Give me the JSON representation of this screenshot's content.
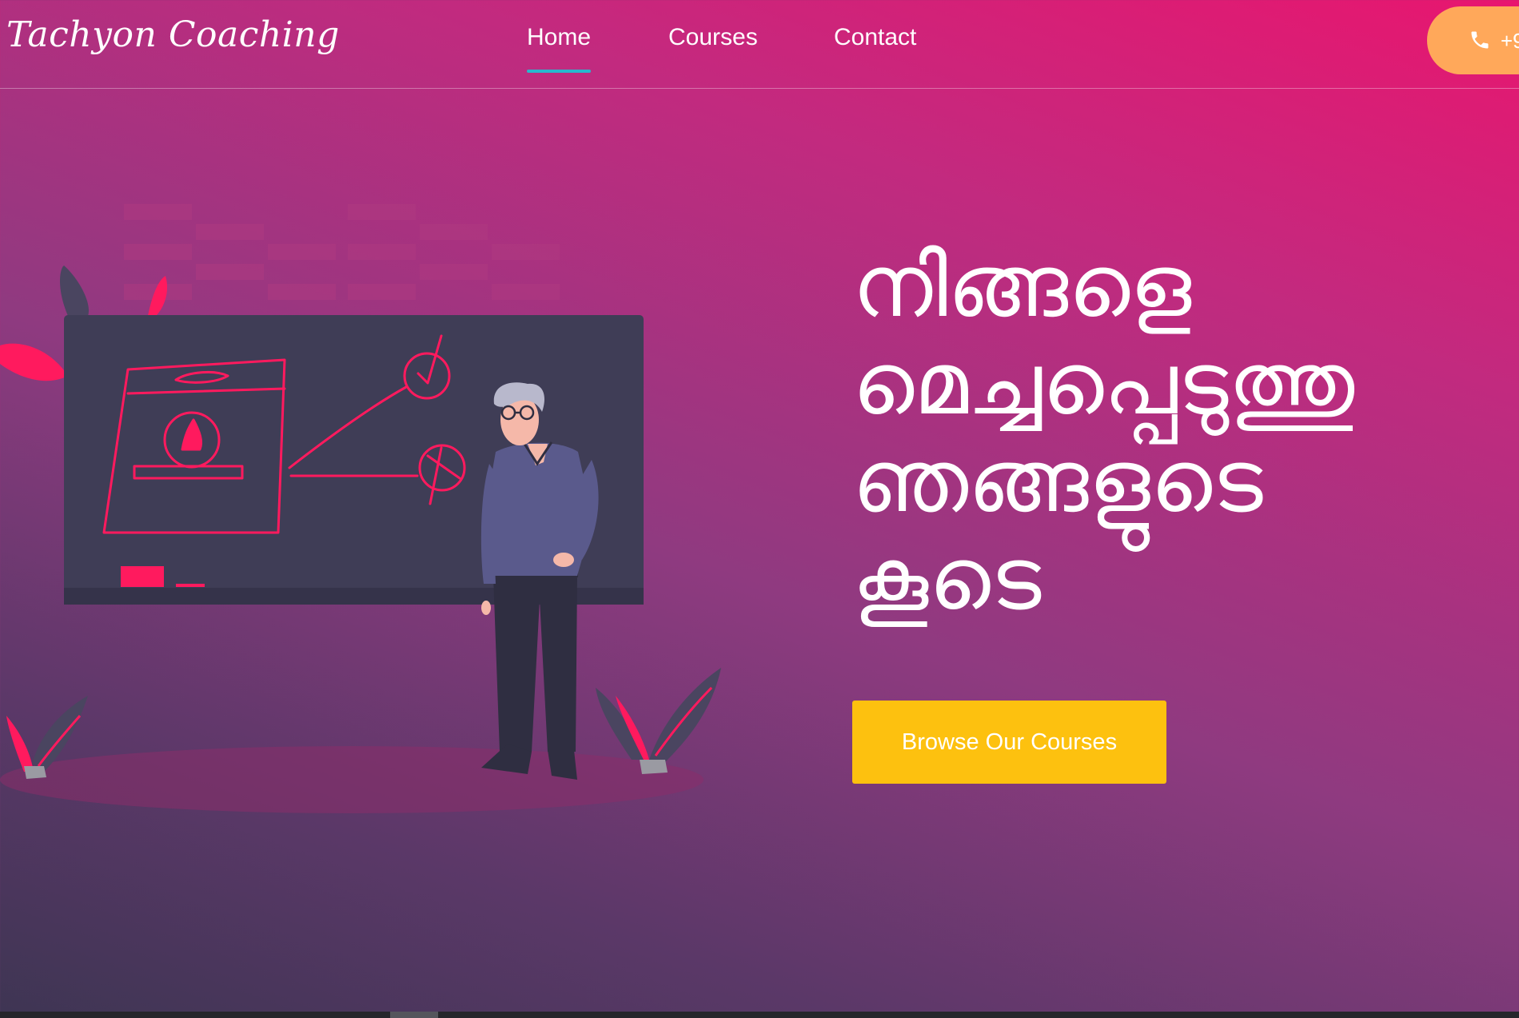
{
  "brand": {
    "name": "Tachyon Coaching"
  },
  "nav": {
    "items": [
      {
        "label": "Home",
        "active": true
      },
      {
        "label": "Courses",
        "active": false
      },
      {
        "label": "Contact",
        "active": false
      }
    ]
  },
  "phone": {
    "text": "+9",
    "icon": "phone-icon"
  },
  "hero": {
    "lines": [
      "നിങ്ങളെ",
      "മെച്ചപ്പെടുത്തു",
      "ഞങ്ങളുടെ",
      "കൂടെ"
    ],
    "cta_label": "Browse Our Courses"
  },
  "colors": {
    "gradient_top_right": "#e8166f",
    "gradient_bottom_left": "#3e3553",
    "cta": "#fdc10f",
    "phone_button": "#ffa85a",
    "active_underline": "#27b8cf",
    "accent_pink": "#ff0a5a"
  }
}
